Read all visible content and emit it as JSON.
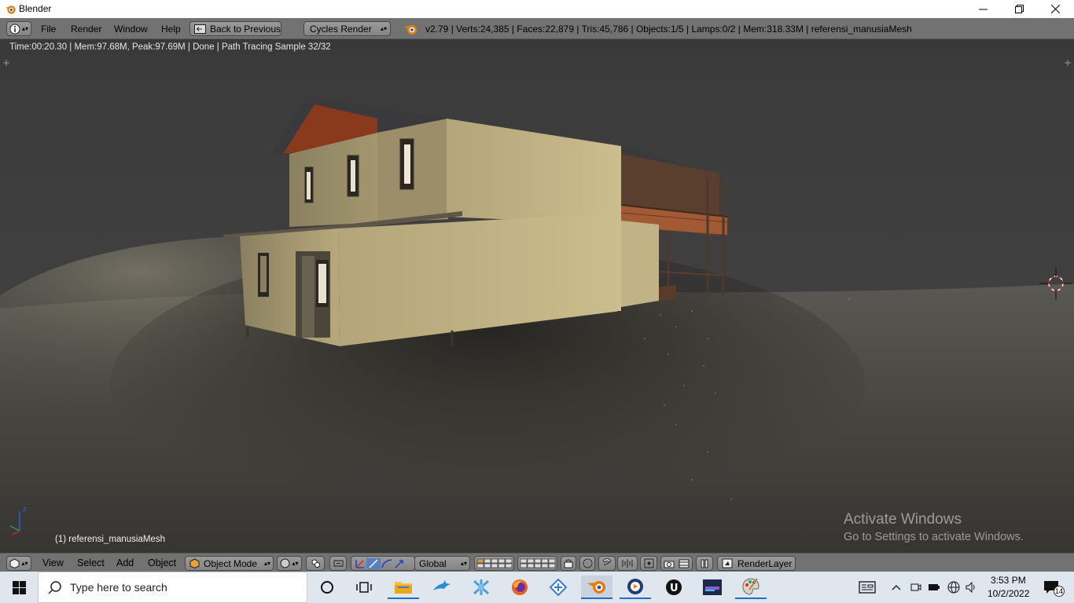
{
  "window": {
    "title": "Blender"
  },
  "header": {
    "menus": [
      "File",
      "Render",
      "Window",
      "Help"
    ],
    "back_button": "Back to Previous",
    "render_engine": "Cycles Render",
    "stats": "v2.79 | Verts:24,385 | Faces:22,879 | Tris:45,786 | Objects:1/5 | Lamps:0/2 | Mem:318.33M | referensi_manusiaMesh"
  },
  "render_status": "Time:00:20.30 | Mem:97.68M, Peak:97.69M | Done | Path Tracing Sample 32/32",
  "viewport": {
    "object_label": "(1) referensi_manusiaMesh",
    "watermark_title": "Activate Windows",
    "watermark_sub": "Go to Settings to activate Windows."
  },
  "footer": {
    "menus": [
      "View",
      "Select",
      "Add",
      "Object"
    ],
    "mode": "Object Mode",
    "orientation": "Global",
    "render_layer": "RenderLayer"
  },
  "taskbar": {
    "search_placeholder": "Type here to search",
    "time": "3:53 PM",
    "date": "10/2/2022",
    "notification_count": "14"
  },
  "colors": {
    "header_bg": "#727272",
    "viewport_bg": "#3a3a3a",
    "taskbar_bg": "#dfe6ee",
    "blender_orange": "#e87d0d"
  }
}
